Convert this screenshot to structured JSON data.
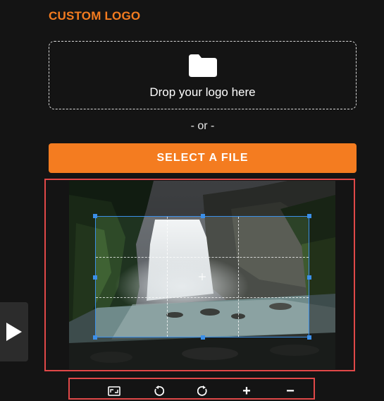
{
  "logo_section": {
    "title": "CUSTOM LOGO",
    "dropzone": {
      "icon": "folder-icon",
      "label": "Drop your logo here"
    },
    "or_label": "- or -",
    "select_button_label": "SELECT A FILE"
  },
  "cropper": {
    "image_subject": "waterfall photo",
    "selection_color": "#3b8fe8",
    "highlight_color": "#e04848"
  },
  "toolbar": {
    "tools": [
      {
        "name": "aspect-ratio-icon"
      },
      {
        "name": "rotate-left-icon"
      },
      {
        "name": "rotate-right-icon"
      },
      {
        "name": "zoom-in-icon",
        "label": "+"
      },
      {
        "name": "zoom-out-icon",
        "label": "−"
      }
    ]
  },
  "side_panel": {
    "icon": "play-icon"
  },
  "colors": {
    "accent": "#f47c20",
    "background": "#141414"
  }
}
